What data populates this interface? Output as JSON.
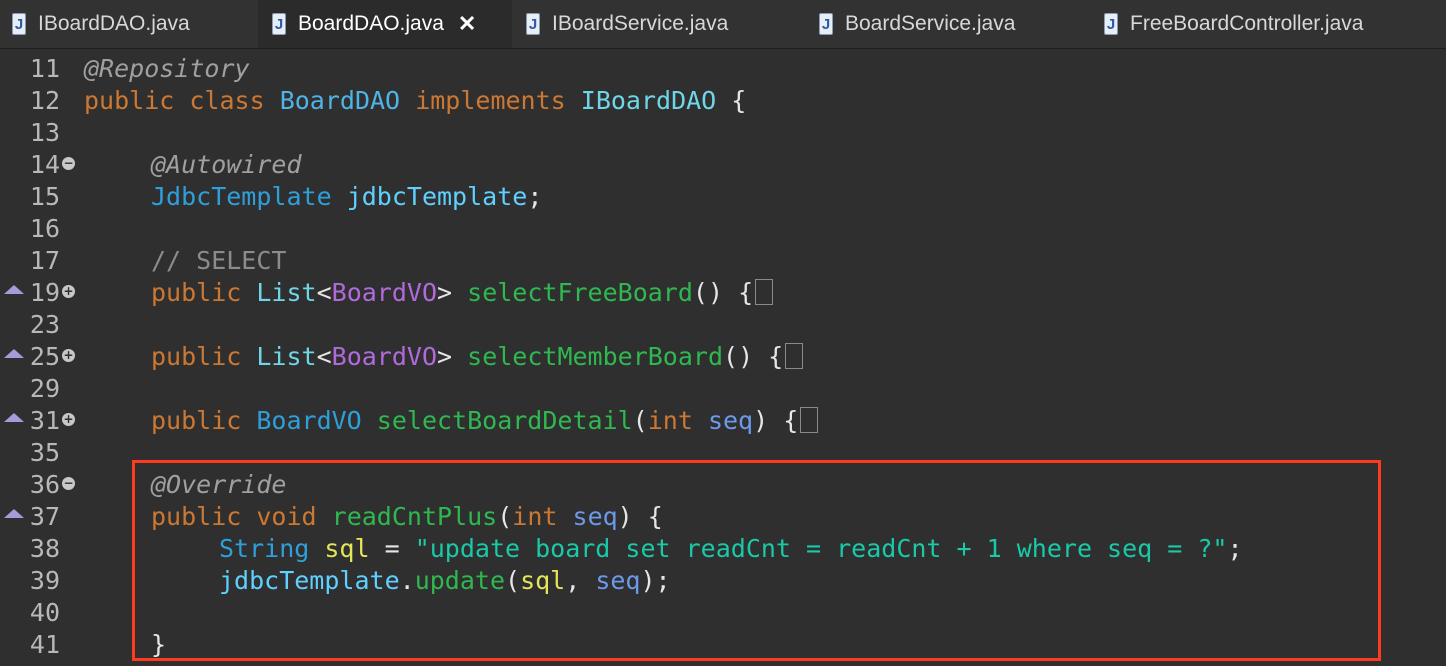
{
  "tabs": [
    {
      "label": "IBoardDAO.java",
      "active": false
    },
    {
      "label": "BoardDAO.java",
      "active": true,
      "close_icon": "close-icon"
    },
    {
      "label": "IBoardService.java",
      "active": false
    },
    {
      "label": "BoardService.java",
      "active": false
    },
    {
      "label": "FreeBoardController.java",
      "active": false
    }
  ],
  "file_icon_glyph": "J",
  "gutter": {
    "line_numbers": [
      "11",
      "12",
      "13",
      "14",
      "15",
      "16",
      "17",
      "19",
      "23",
      "25",
      "29",
      "31",
      "35",
      "36",
      "37",
      "38",
      "39",
      "40",
      "41"
    ]
  },
  "code": {
    "l11_ann": "@Repository",
    "l12_public": "public",
    "l12_class": "class",
    "l12_name": "BoardDAO",
    "l12_implements": "implements",
    "l12_iface": "IBoardDAO",
    "l12_brace": " {",
    "l14_ann": "@Autowired",
    "l15_type": "JdbcTemplate",
    "l15_field": "jdbcTemplate",
    "l15_semi": ";",
    "l17_comment": "// SELECT",
    "l19_public": "public",
    "l19_list": "List",
    "l19_lt": "<",
    "l19_gen": "BoardVO",
    "l19_gt": ">",
    "l19_method": "selectFreeBoard",
    "l19_rest": "() {",
    "l25_public": "public",
    "l25_list": "List",
    "l25_lt": "<",
    "l25_gen": "BoardVO",
    "l25_gt": ">",
    "l25_method": "selectMemberBoard",
    "l25_rest": "() {",
    "l31_public": "public",
    "l31_type": "BoardVO",
    "l31_method": "selectBoardDetail",
    "l31_open": "(",
    "l31_int": "int",
    "l31_param": "seq",
    "l31_rest": ") {",
    "l36_ann": "@Override",
    "l37_public": "public",
    "l37_void": "void",
    "l37_method": "readCntPlus",
    "l37_open": "(",
    "l37_int": "int",
    "l37_param": "seq",
    "l37_rest": ") {",
    "l38_type": "String",
    "l38_var": "sql",
    "l38_eq": " = ",
    "l38_str": "\"update board set readCnt = readCnt + 1 where seq = ?\"",
    "l38_semi": ";",
    "l39_field": "jdbcTemplate",
    "l39_dot": ".",
    "l39_method": "update",
    "l39_open": "(",
    "l39_arg1": "sql",
    "l39_comma": ", ",
    "l39_arg2": "seq",
    "l39_close": ");",
    "l41_brace": "}"
  },
  "colors": {
    "highlight_border": "#ff3b1f",
    "keyword": "#cc7832",
    "string": "#19c9a7",
    "method": "#2fb84f"
  }
}
